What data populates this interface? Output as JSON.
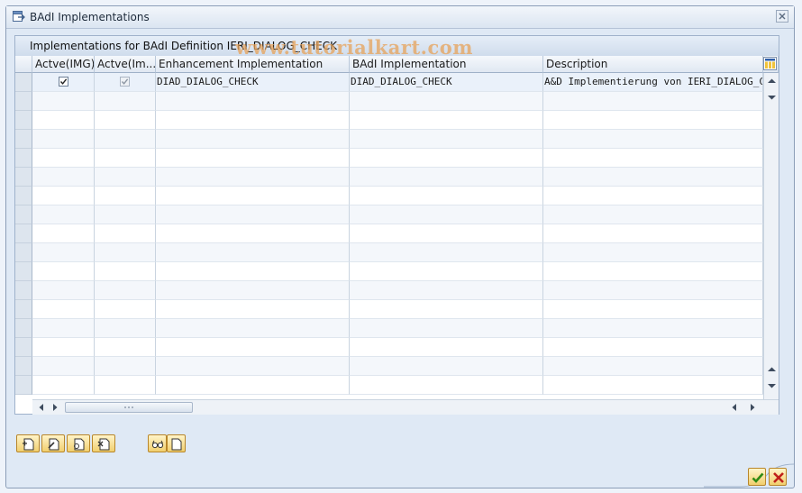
{
  "window": {
    "title": "BAdI Implementations"
  },
  "panel": {
    "title": "Implementations for BAdI Definition IERI_DIALOG_CHECK",
    "watermark": "www.tutorialkart.com"
  },
  "table": {
    "columns": [
      {
        "label": "Actve(IMG)"
      },
      {
        "label": "Actve(Im..."
      },
      {
        "label": "Enhancement Implementation"
      },
      {
        "label": "BAdI Implementation"
      },
      {
        "label": "Description"
      }
    ],
    "rows": [
      {
        "active_img": true,
        "active_impl": true,
        "enhancement_implementation": "DIAD_DIALOG_CHECK",
        "badi_implementation": "DIAD_DIALOG_CHECK",
        "description": "A&D Implementierung von IERI_DIALOG_CHECK"
      }
    ],
    "empty_row_count": 16
  },
  "toolbar": {
    "buttons": [
      {
        "icon": "create-implementation-icon"
      },
      {
        "icon": "change-implementation-icon"
      },
      {
        "icon": "display-implementation-icon"
      },
      {
        "icon": "delete-implementation-icon"
      },
      {
        "icon": "glasses-display-icon"
      },
      {
        "icon": "document-icon"
      }
    ]
  },
  "footer": {
    "confirm_icon": "checkmark-icon",
    "cancel_icon": "cancel-x-icon",
    "colors": {
      "confirm": "#2f8a14",
      "cancel": "#c0201a"
    }
  },
  "colors": {
    "accent": "#f1cf6e",
    "watermark": "#e7a35b"
  }
}
